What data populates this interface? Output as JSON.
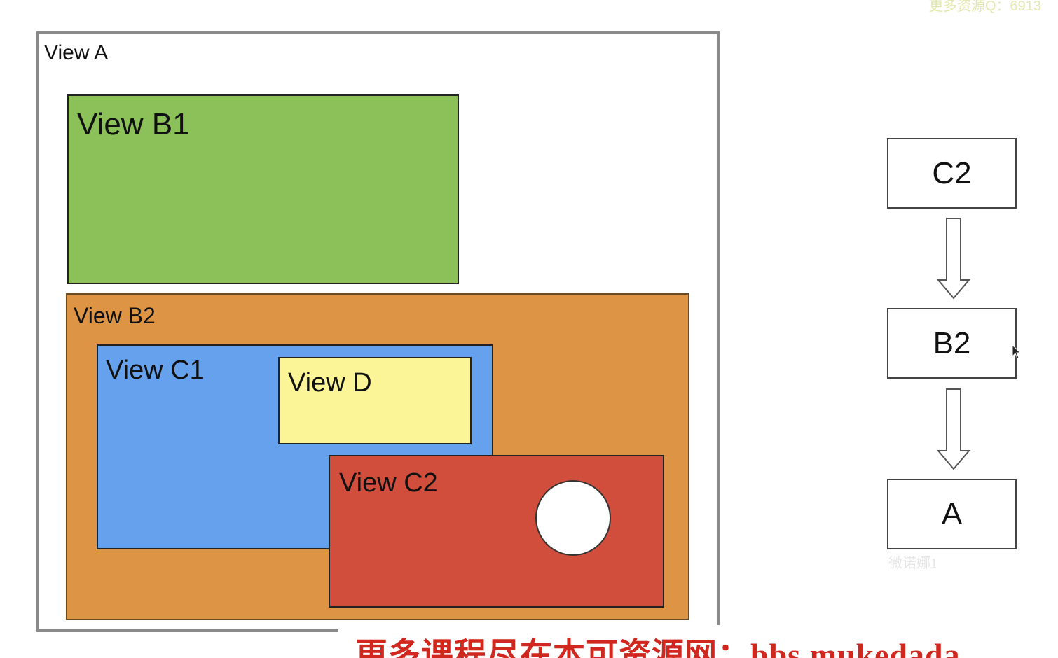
{
  "colors": {
    "view_a_border": "#8a8a8a",
    "view_b1": "#8cc059",
    "view_b2": "#dd9545",
    "view_c1": "#66a1ee",
    "view_d": "#fbf597",
    "view_c2": "#d04e3b",
    "banner_text": "#d0271e"
  },
  "diagram": {
    "view_a": "View A",
    "view_b1": "View B1",
    "view_b2": "View B2",
    "view_c1": "View C1",
    "view_d": "View D",
    "view_c2": "View C2"
  },
  "chain": {
    "nodes": [
      "C2",
      "B2",
      "A"
    ]
  },
  "watermarks": {
    "top_right": "更多资源Q：6913",
    "under_node": "微诺娜1"
  },
  "banner": {
    "text": "更多课程尽在本可资源网：bbs.mukedada"
  }
}
